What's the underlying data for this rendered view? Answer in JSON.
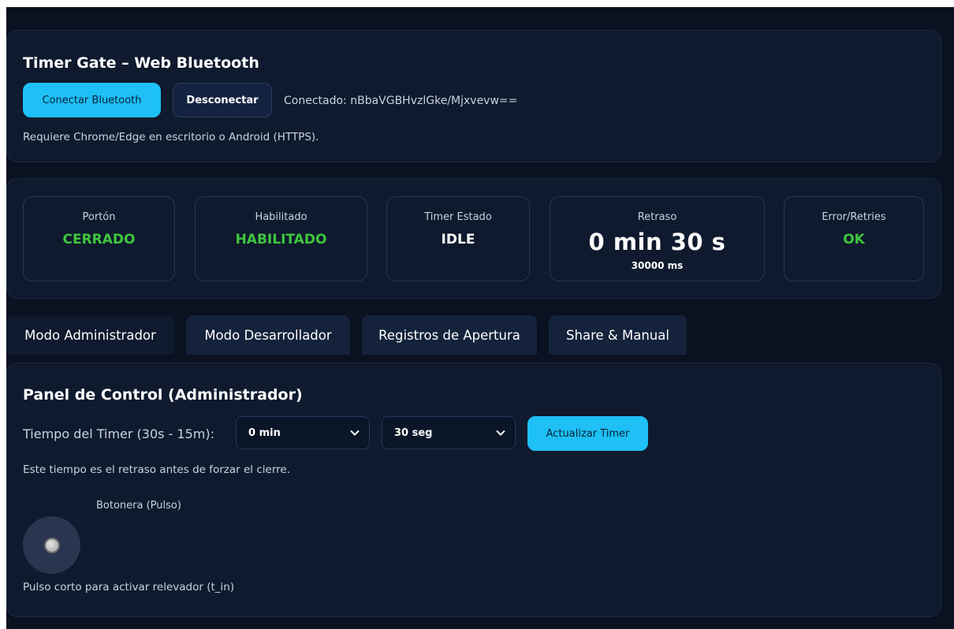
{
  "header": {
    "title": "Timer Gate – Web Bluetooth",
    "connect_label": "Conectar Bluetooth",
    "disconnect_label": "Desconectar",
    "connection_status": "Conectado: nBbaVGBHvzlGke/Mjxvevw==",
    "requirement_note": "Requiere Chrome/Edge en escritorio o Android (HTTPS)."
  },
  "stats": [
    {
      "label": "Portón",
      "value": "CERRADO"
    },
    {
      "label": "Habilitado",
      "value": "HABILITADO"
    },
    {
      "label": "Timer Estado",
      "value": "IDLE"
    },
    {
      "label": "Retraso",
      "value": "0 min 30 s",
      "sub": "30000 ms"
    },
    {
      "label": "Error/Retries",
      "value": "OK"
    }
  ],
  "tabs": [
    {
      "label": "Modo Administrador"
    },
    {
      "label": "Modo Desarrollador"
    },
    {
      "label": "Registros de Apertura"
    },
    {
      "label": "Share & Manual"
    }
  ],
  "panel": {
    "title": "Panel de Control (Administrador)",
    "timer_label": "Tiempo del Timer (30s - 15m):",
    "minutes_selected": "0 min",
    "seconds_selected": "30 seg",
    "update_label": "Actualizar Timer",
    "timer_note": "Este tiempo es el retraso antes de forzar el cierre.",
    "pulse_label": "Botonera (Pulso)",
    "pulse_note": "Pulso corto para activar relevador (t_in)"
  },
  "colors": {
    "accent": "#1ec0f5",
    "success": "#3fc63c",
    "background": "#0a1120",
    "card": "#0f1a2e"
  },
  "icons": {
    "select_chevron": "chevron-down-icon",
    "pulse_button": "pulse-button-icon"
  }
}
